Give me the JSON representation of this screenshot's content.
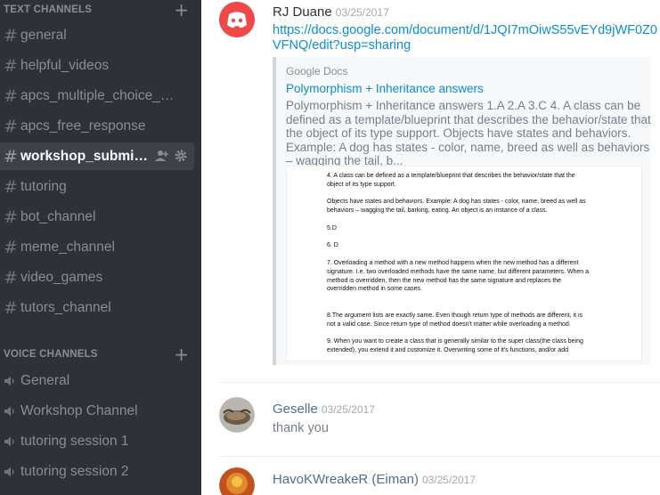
{
  "sidebar": {
    "text_header": "TEXT CHANNELS",
    "voice_header": "VOICE CHANNELS",
    "add_symbol": "+",
    "text_channels": [
      {
        "name": "general"
      },
      {
        "name": "helpful_videos"
      },
      {
        "name": "apcs_multiple_choice_qu..."
      },
      {
        "name": "apcs_free_response"
      },
      {
        "name": "workshop_submissi...",
        "active": true
      },
      {
        "name": "tutoring"
      },
      {
        "name": "bot_channel"
      },
      {
        "name": "meme_channel"
      },
      {
        "name": "video_games"
      },
      {
        "name": "tutors_channel"
      }
    ],
    "voice_channels": [
      {
        "name": "General"
      },
      {
        "name": "Workshop Channel"
      },
      {
        "name": "tutoring session 1"
      },
      {
        "name": "tutoring session 2"
      }
    ]
  },
  "chat": {
    "messages": [
      {
        "author": "RJ Duane",
        "author_color": "#2e3136",
        "timestamp": "03/25/2017",
        "link": "https://docs.google.com/document/d/1JQI7mOiwS55vEYd9jWF0Z0VFNQ/edit?usp=sharing",
        "embed": {
          "provider": "Google Docs",
          "title": "Polymorphism + Inheritance answers",
          "description": "Polymorphism + Inheritance answers 1.A 2.A 3.C 4. A class can be defined as a template/blueprint that describes the behavior/state that the object of its type support. Objects have states and behaviors. Example: A dog has states - color, name, breed as well as behaviors – wagging the tail, b...",
          "doc_lines": [
            "4. A class can be defined as a template/blueprint that describes the behavior/state that the",
            "object of its type support.",
            "",
            "Objects have states and behaviors. Example: A dog has states - color, name, breed as well as",
            "behaviors – wagging the tail, barking, eating. An object is an instance of a class.",
            "",
            "5.D",
            "",
            "6. D",
            "",
            "7. Overloading a method with a new method happens when the new method has a different",
            "signature. I.e. two overloaded methods have the same name, but different parameters. When a",
            "method is overridden, then the new method has the same signature and replaces the",
            "overridden method in some cases.",
            "",
            "",
            "8.The argument lists are exactly same. Even though return type of methods are different, it is",
            "not a valid case. Since return type of method doesn't matter while overloading a method.",
            "",
            "9. When you want to create a class that is generally similar to the super class(the class being",
            "extended), you extend it and customize it. Overwriting some of it's functions, and/or add"
          ]
        }
      },
      {
        "author": "Geselle",
        "author_color": "#4f6f8f",
        "timestamp": "03/25/2017",
        "text": "thank you"
      },
      {
        "author": "HavoKWreakeR (Eiman)",
        "author_color": "#4f6f8f",
        "timestamp": "03/25/2017"
      }
    ]
  }
}
